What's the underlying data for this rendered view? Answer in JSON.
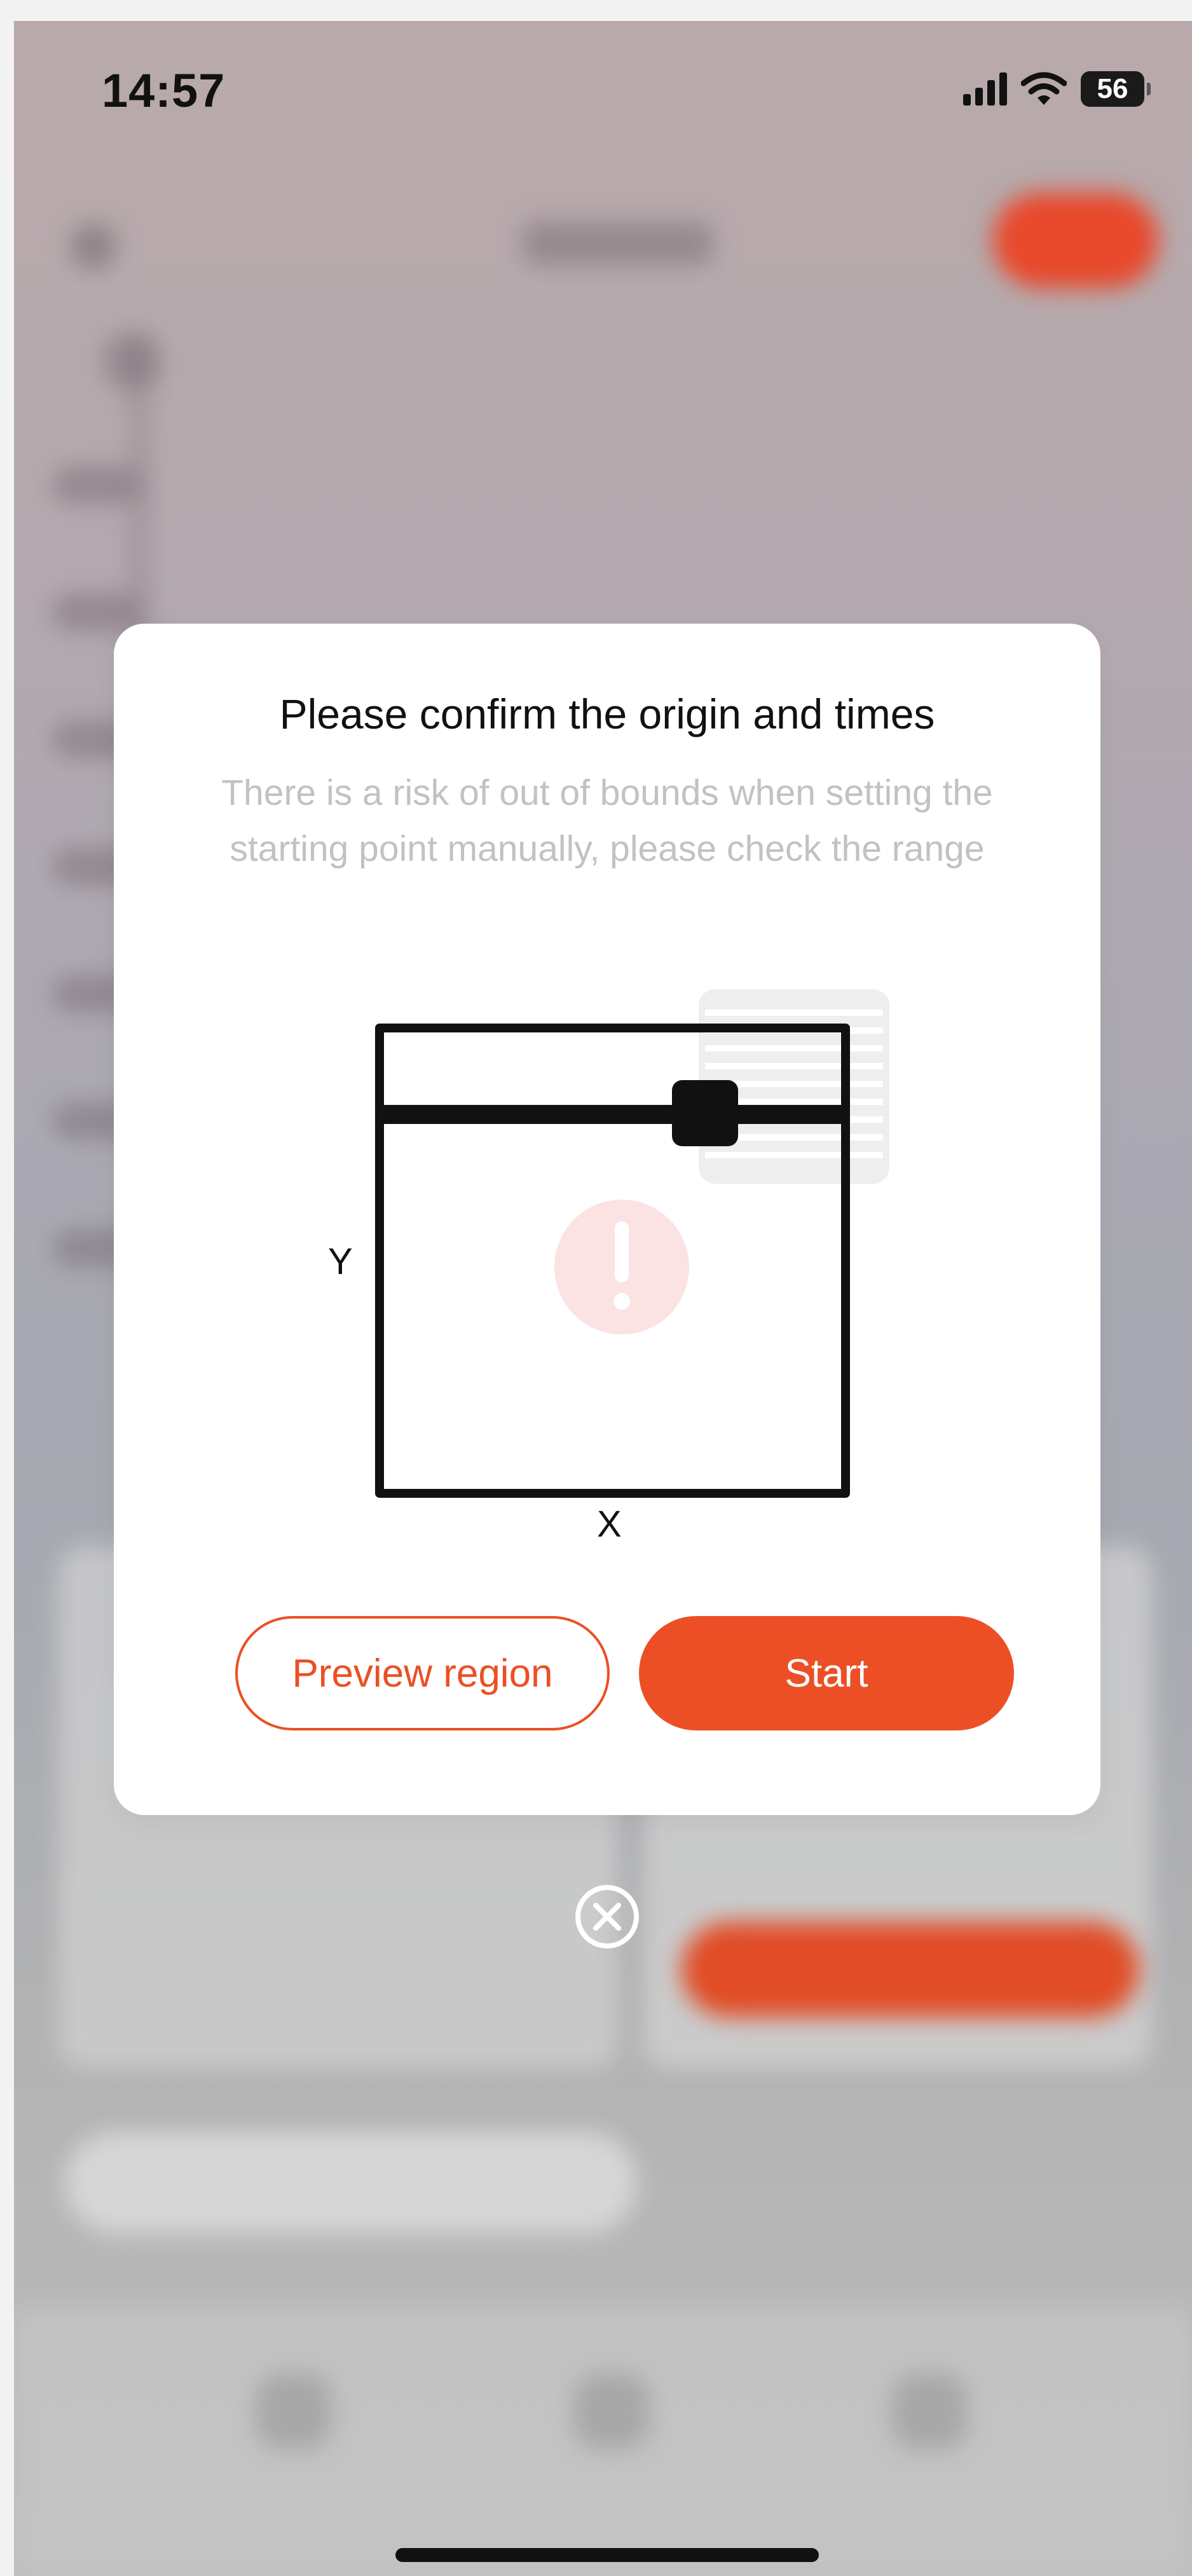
{
  "status_bar": {
    "time": "14:57",
    "battery": "56",
    "icons": [
      "cellular-signal-icon",
      "wifi-icon",
      "battery-icon"
    ]
  },
  "dialog": {
    "title": "Please confirm the origin and times",
    "description": "There is a risk of out of bounds when setting the starting point manually, please check the range",
    "diagram": {
      "x_label": "X",
      "y_label": "Y",
      "icons": [
        "laser-head-icon",
        "warning-exclamation-icon",
        "engraving-image-icon"
      ]
    },
    "buttons": {
      "preview_label": "Preview region",
      "start_label": "Start"
    },
    "close_icon": "close-circle-icon"
  },
  "colors": {
    "accent": "#ec4f25",
    "title_text": "#111111",
    "description_text": "#c2c2c2",
    "warning_badge": "#fbe3e3"
  }
}
